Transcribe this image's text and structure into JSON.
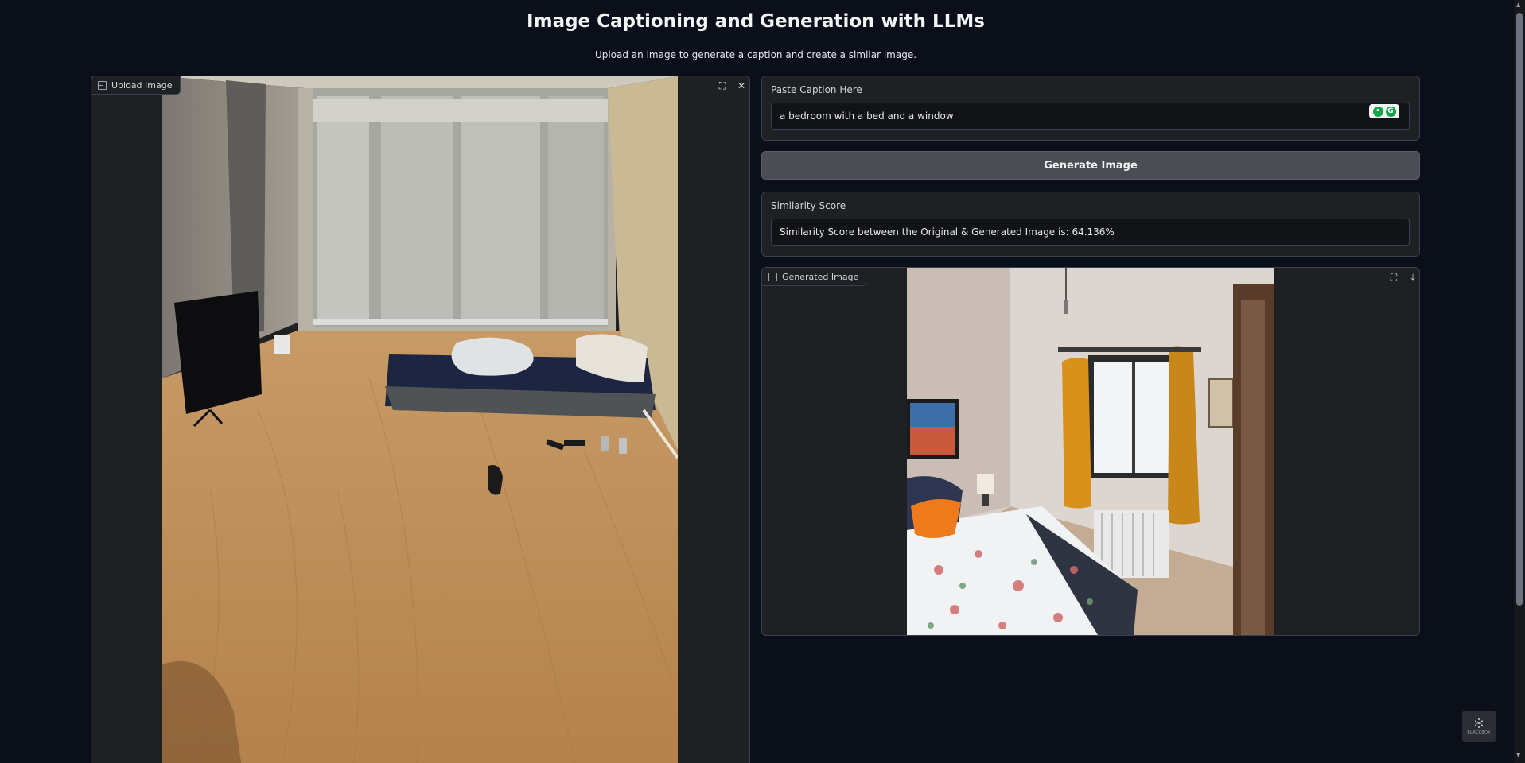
{
  "header": {
    "title": "Image Captioning and Generation with LLMs",
    "subtitle": "Upload an image to generate a caption and create a similar image."
  },
  "upload": {
    "label": "Upload Image",
    "icon": "image-icon"
  },
  "caption": {
    "label": "Paste Caption Here",
    "value": "a bedroom with a bed and a window"
  },
  "generate_button": {
    "label": "Generate Image"
  },
  "similarity": {
    "label": "Similarity Score",
    "value": "Similarity Score between the Original & Generated Image is: 64.136%"
  },
  "generated": {
    "label": "Generated Image",
    "icon": "image-icon"
  },
  "badge": {
    "text": "BLACKBOX"
  },
  "colors": {
    "background": "#0b0f19",
    "panel": "#1f2023",
    "button": "#4b4d55",
    "border": "#374151"
  }
}
